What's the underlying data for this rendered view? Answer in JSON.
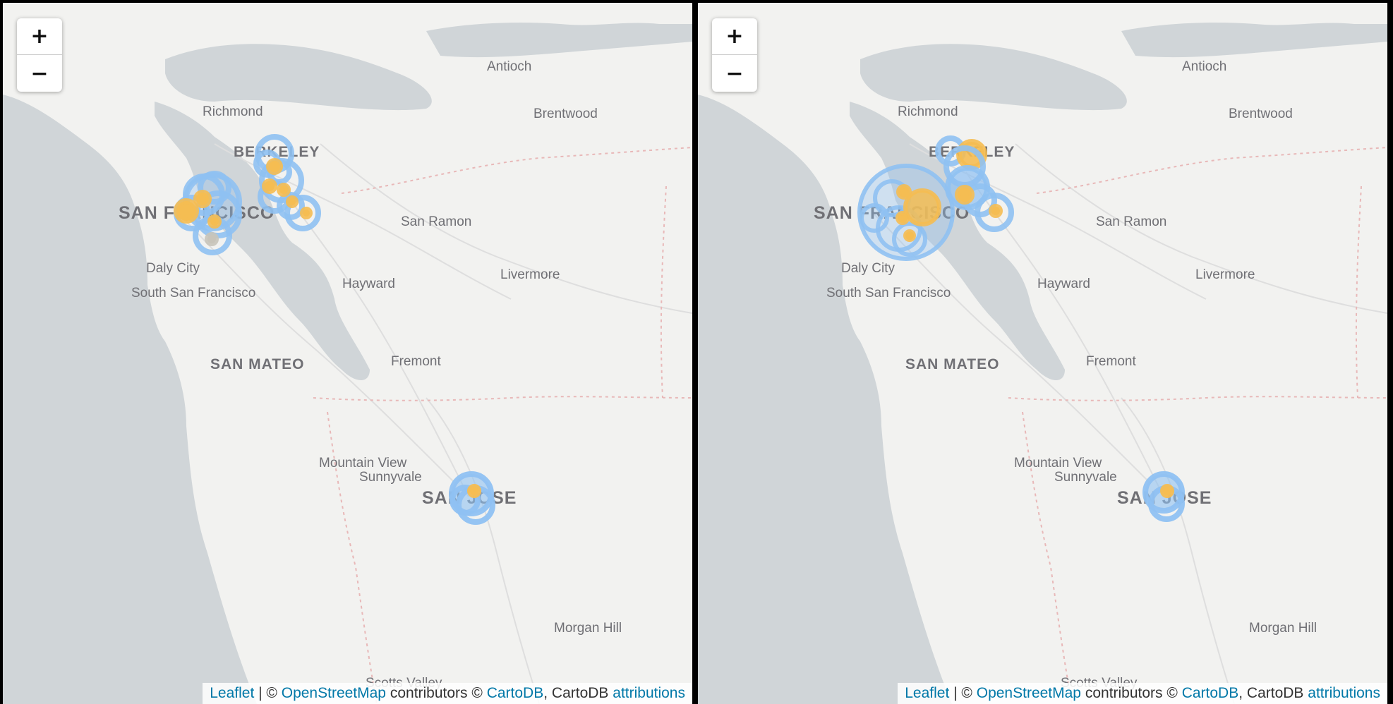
{
  "maps": [
    {
      "zoom": {
        "in_label": "+",
        "out_label": "−"
      },
      "attribution": {
        "leaflet": "Leaflet",
        "sep": " | © ",
        "osm": "OpenStreetMap",
        "contrib": " contributors © ",
        "carto": "CartoDB",
        "comma": ", CartoDB ",
        "attributions": "attributions"
      }
    },
    {
      "zoom": {
        "in_label": "+",
        "out_label": "−"
      },
      "attribution": {
        "leaflet": "Leaflet",
        "sep": " | © ",
        "osm": "OpenStreetMap",
        "contrib": " contributors © ",
        "carto": "CartoDB",
        "comma": ", CartoDB ",
        "attributions": "attributions"
      }
    }
  ],
  "labels": {
    "antioch": "Antioch",
    "richmond": "Richmond",
    "brentwood": "Brentwood",
    "berkeley": "BERKELEY",
    "san_francisco": "SAN FRANCISCO",
    "san_ramon": "San Ramon",
    "daly_city": "Daly City",
    "south_sf": "South San Francisco",
    "hayward": "Hayward",
    "livermore": "Livermore",
    "san_mateo": "SAN MATEO",
    "fremont": "Fremont",
    "mountain_view": "Mountain View",
    "sunnyvale": "Sunnyvale",
    "san_jose": "SAN JOSE",
    "morgan_hill": "Morgan Hill",
    "scotts_valley": "Scotts Valley"
  },
  "colors": {
    "circle_blue": "#8fc1f2",
    "circle_orange": "#f5bd52",
    "water": "#d0d5d8",
    "land": "#f2f2f0"
  }
}
